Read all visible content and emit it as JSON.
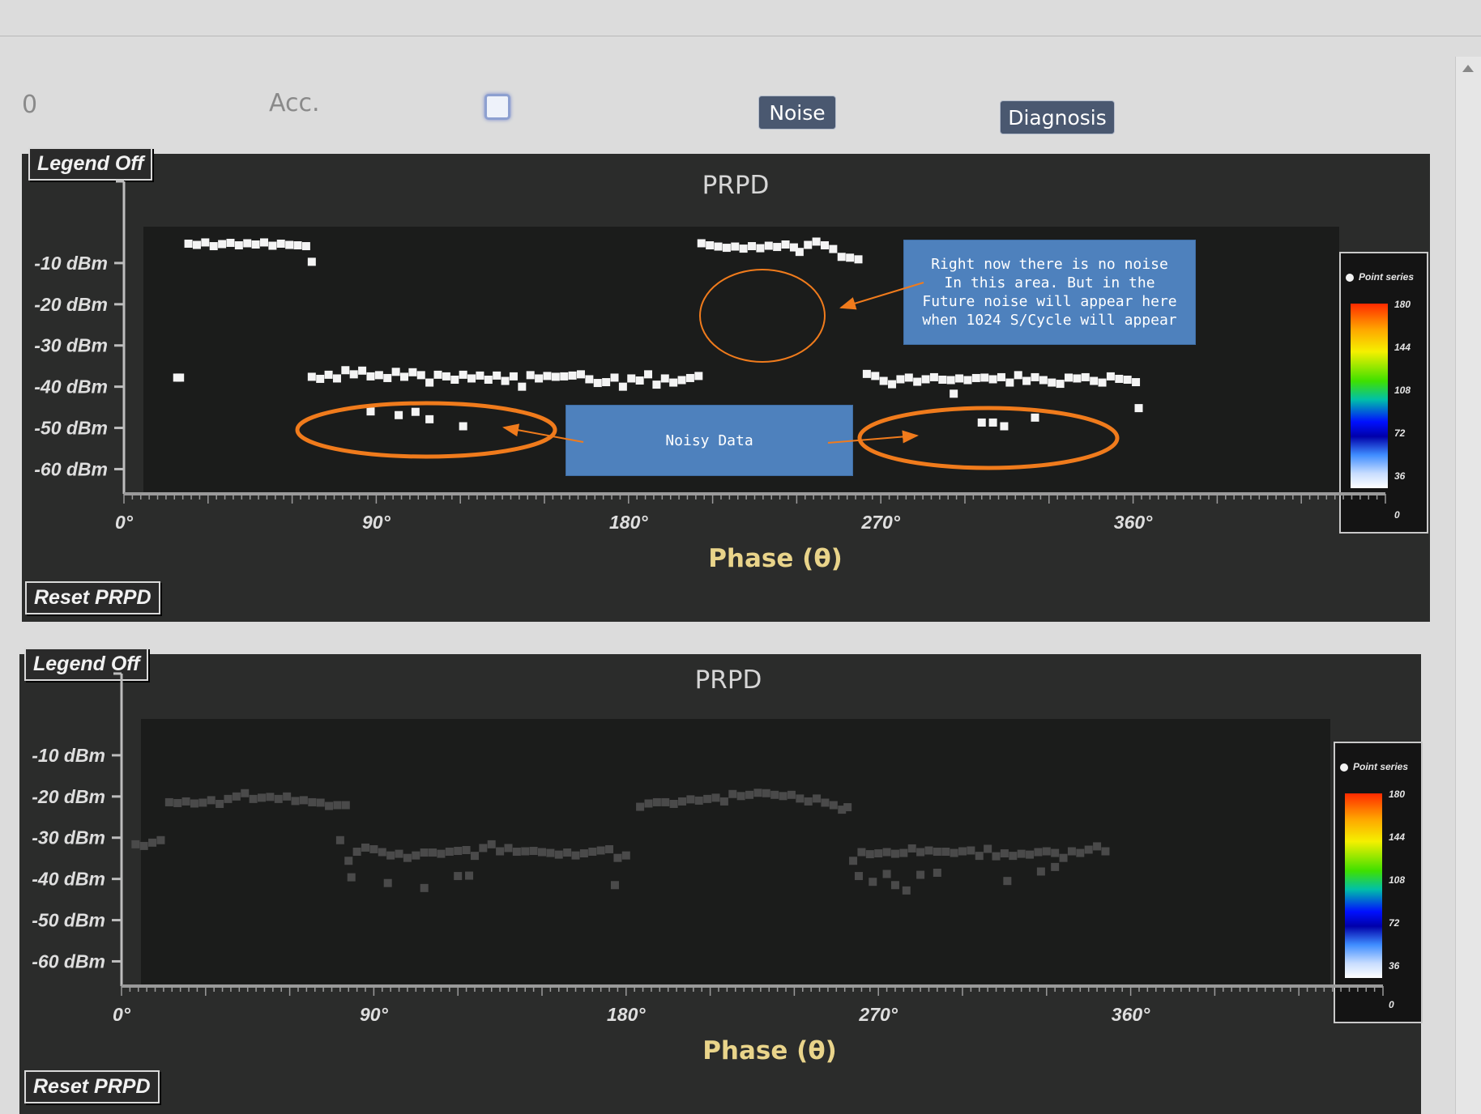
{
  "toolbar": {
    "left_value": "0",
    "acc_label": "Acc.",
    "noise_label": "Noise",
    "diagnosis_label": "Diagnosis"
  },
  "panels": [
    {
      "title": "PRPD",
      "legend_button": "Legend Off",
      "reset_button": "Reset PRPD",
      "legend": {
        "series": "Point series",
        "ticks": [
          "180",
          "144",
          "108",
          "72",
          "36",
          "0"
        ]
      }
    },
    {
      "title": "PRPD",
      "legend_button": "Legend Off",
      "reset_button": "Reset PRPD",
      "legend": {
        "series": "Point series",
        "ticks": [
          "180",
          "144",
          "108",
          "72",
          "36",
          "0"
        ]
      }
    }
  ],
  "annotations": {
    "callout_future": "Right now there is no noise\nIn this area. But in the\nFuture noise will appear here\nwhen 1024 S/Cycle will appear",
    "callout_noisy": "Noisy Data",
    "accent_color": "#f07b1c",
    "callout_color": "#4e81bd"
  },
  "chart_data": [
    {
      "type": "scatter",
      "title": "PRPD",
      "xlabel": "Phase (θ)",
      "ylabel": "",
      "x_ticks": [
        "0°",
        "90°",
        "180°",
        "270°",
        "360°"
      ],
      "y_ticks": [
        "-10 dBm",
        "-20 dBm",
        "-30 dBm",
        "-40 dBm",
        "-50 dBm",
        "-60 dBm"
      ],
      "xlim": [
        0,
        450
      ],
      "ylim": [
        -66,
        0
      ],
      "point_color": "#f4f4f4",
      "series": [
        {
          "points": [
            [
              23,
              -5.3
            ],
            [
              26,
              -5.6
            ],
            [
              29,
              -5.0
            ],
            [
              32,
              -5.9
            ],
            [
              35,
              -5.4
            ],
            [
              38,
              -5.1
            ],
            [
              41,
              -5.7
            ],
            [
              44,
              -5.2
            ],
            [
              47,
              -5.5
            ],
            [
              50,
              -5.0
            ],
            [
              53,
              -5.8
            ],
            [
              56,
              -5.3
            ],
            [
              59,
              -5.6
            ],
            [
              62,
              -5.7
            ],
            [
              65,
              -5.9
            ],
            [
              67,
              -9.7
            ],
            [
              206,
              -5.2
            ],
            [
              209,
              -5.7
            ],
            [
              212,
              -6.0
            ],
            [
              215,
              -6.3
            ],
            [
              218,
              -6.0
            ],
            [
              221,
              -6.5
            ],
            [
              224,
              -5.9
            ],
            [
              227,
              -6.4
            ],
            [
              230,
              -5.8
            ],
            [
              233,
              -6.1
            ],
            [
              236,
              -5.5
            ],
            [
              239,
              -6.2
            ],
            [
              241,
              -7.3
            ],
            [
              244,
              -5.6
            ],
            [
              247,
              -4.8
            ],
            [
              250,
              -5.7
            ],
            [
              253,
              -6.6
            ],
            [
              256,
              -8.5
            ],
            [
              259,
              -8.7
            ],
            [
              262,
              -9.1
            ],
            [
              19,
              -37.8
            ],
            [
              20,
              -37.8
            ],
            [
              67,
              -37.6
            ],
            [
              70,
              -38.1
            ],
            [
              73,
              -37.1
            ],
            [
              76,
              -38.0
            ],
            [
              79,
              -36.0
            ],
            [
              82,
              -37.0
            ],
            [
              85,
              -36.1
            ],
            [
              88,
              -37.5
            ],
            [
              91,
              -37.2
            ],
            [
              94,
              -37.9
            ],
            [
              97,
              -36.4
            ],
            [
              100,
              -37.6
            ],
            [
              103,
              -36.5
            ],
            [
              106,
              -37.2
            ],
            [
              109,
              -39.0
            ],
            [
              112,
              -37.1
            ],
            [
              115,
              -37.5
            ],
            [
              118,
              -38.3
            ],
            [
              121,
              -37.1
            ],
            [
              124,
              -38.0
            ],
            [
              127,
              -37.3
            ],
            [
              130,
              -38.3
            ],
            [
              133,
              -37.3
            ],
            [
              136,
              -38.6
            ],
            [
              139,
              -37.5
            ],
            [
              142,
              -40.0
            ],
            [
              145,
              -37.2
            ],
            [
              148,
              -38.0
            ],
            [
              151,
              -37.4
            ],
            [
              154,
              -37.6
            ],
            [
              157,
              -37.5
            ],
            [
              160,
              -37.3
            ],
            [
              163,
              -37.0
            ],
            [
              166,
              -38.2
            ],
            [
              169,
              -39.1
            ],
            [
              172,
              -38.9
            ],
            [
              175,
              -37.8
            ],
            [
              178,
              -40.0
            ],
            [
              181,
              -38.0
            ],
            [
              184,
              -38.5
            ],
            [
              187,
              -37.0
            ],
            [
              190,
              -39.5
            ],
            [
              193,
              -38.0
            ],
            [
              196,
              -39.0
            ],
            [
              199,
              -38.4
            ],
            [
              202,
              -37.9
            ],
            [
              205,
              -37.4
            ],
            [
              265,
              -36.9
            ],
            [
              268,
              -37.4
            ],
            [
              271,
              -38.6
            ],
            [
              274,
              -39.4
            ],
            [
              277,
              -38.2
            ],
            [
              280,
              -37.8
            ],
            [
              283,
              -38.8
            ],
            [
              286,
              -38.2
            ],
            [
              289,
              -37.7
            ],
            [
              292,
              -38.3
            ],
            [
              295,
              -38.4
            ],
            [
              298,
              -38.0
            ],
            [
              301,
              -38.4
            ],
            [
              304,
              -37.9
            ],
            [
              307,
              -37.8
            ],
            [
              310,
              -38.2
            ],
            [
              313,
              -37.7
            ],
            [
              316,
              -39.0
            ],
            [
              319,
              -37.2
            ],
            [
              322,
              -38.6
            ],
            [
              325,
              -37.7
            ],
            [
              328,
              -38.4
            ],
            [
              331,
              -39.0
            ],
            [
              334,
              -39.3
            ],
            [
              337,
              -37.8
            ],
            [
              340,
              -38.0
            ],
            [
              343,
              -37.7
            ],
            [
              346,
              -38.6
            ],
            [
              349,
              -39.0
            ],
            [
              352,
              -37.5
            ],
            [
              355,
              -38.1
            ],
            [
              358,
              -38.3
            ],
            [
              361,
              -38.9
            ],
            [
              296,
              -41.7
            ],
            [
              362,
              -45.2
            ],
            [
              88,
              -46.0
            ],
            [
              98,
              -46.9
            ],
            [
              104,
              -46.1
            ],
            [
              109,
              -47.9
            ],
            [
              121,
              -49.6
            ],
            [
              306,
              -48.7
            ],
            [
              310,
              -48.7
            ],
            [
              314,
              -49.6
            ],
            [
              325,
              -47.5
            ]
          ]
        }
      ]
    },
    {
      "type": "scatter",
      "title": "PRPD",
      "xlabel": "Phase (θ)",
      "ylabel": "",
      "x_ticks": [
        "0°",
        "90°",
        "180°",
        "270°",
        "360°"
      ],
      "y_ticks": [
        "-10 dBm",
        "-20 dBm",
        "-30 dBm",
        "-40 dBm",
        "-50 dBm",
        "-60 dBm"
      ],
      "xlim": [
        0,
        450
      ],
      "ylim": [
        -66,
        0
      ],
      "point_color": "#4a4a4a",
      "series": [
        {
          "points": [
            [
              5,
              -31.6
            ],
            [
              8,
              -32.0
            ],
            [
              11,
              -31.2
            ],
            [
              14,
              -30.6
            ],
            [
              17,
              -21.4
            ],
            [
              20,
              -21.6
            ],
            [
              23,
              -21.2
            ],
            [
              26,
              -21.7
            ],
            [
              29,
              -21.5
            ],
            [
              32,
              -20.9
            ],
            [
              35,
              -21.8
            ],
            [
              38,
              -20.6
            ],
            [
              41,
              -20.0
            ],
            [
              44,
              -19.2
            ],
            [
              47,
              -20.6
            ],
            [
              50,
              -20.3
            ],
            [
              53,
              -20.1
            ],
            [
              56,
              -20.6
            ],
            [
              59,
              -20.0
            ],
            [
              62,
              -21.1
            ],
            [
              65,
              -20.9
            ],
            [
              68,
              -21.4
            ],
            [
              71,
              -21.5
            ],
            [
              74,
              -22.3
            ],
            [
              77,
              -22.1
            ],
            [
              80,
              -22.1
            ],
            [
              185,
              -22.5
            ],
            [
              188,
              -21.7
            ],
            [
              191,
              -21.4
            ],
            [
              194,
              -21.4
            ],
            [
              197,
              -21.8
            ],
            [
              200,
              -21.2
            ],
            [
              203,
              -20.7
            ],
            [
              206,
              -21.0
            ],
            [
              209,
              -20.6
            ],
            [
              212,
              -20.3
            ],
            [
              215,
              -21.2
            ],
            [
              218,
              -19.4
            ],
            [
              221,
              -19.9
            ],
            [
              224,
              -19.6
            ],
            [
              227,
              -19.1
            ],
            [
              230,
              -19.2
            ],
            [
              233,
              -19.6
            ],
            [
              236,
              -19.9
            ],
            [
              239,
              -19.6
            ],
            [
              242,
              -20.5
            ],
            [
              245,
              -21.2
            ],
            [
              248,
              -20.5
            ],
            [
              251,
              -21.5
            ],
            [
              254,
              -22.1
            ],
            [
              257,
              -23.2
            ],
            [
              259,
              -22.6
            ],
            [
              78,
              -30.6
            ],
            [
              81,
              -35.6
            ],
            [
              84,
              -33.4
            ],
            [
              87,
              -32.4
            ],
            [
              90,
              -32.8
            ],
            [
              93,
              -33.5
            ],
            [
              96,
              -34.3
            ],
            [
              99,
              -33.9
            ],
            [
              102,
              -34.9
            ],
            [
              105,
              -34.3
            ],
            [
              108,
              -33.6
            ],
            [
              111,
              -33.6
            ],
            [
              114,
              -33.9
            ],
            [
              117,
              -33.4
            ],
            [
              120,
              -33.2
            ],
            [
              123,
              -33.0
            ],
            [
              126,
              -34.4
            ],
            [
              129,
              -32.5
            ],
            [
              132,
              -31.6
            ],
            [
              135,
              -33.3
            ],
            [
              138,
              -32.5
            ],
            [
              141,
              -33.4
            ],
            [
              144,
              -33.3
            ],
            [
              147,
              -33.2
            ],
            [
              150,
              -33.5
            ],
            [
              153,
              -33.7
            ],
            [
              156,
              -34.1
            ],
            [
              159,
              -33.6
            ],
            [
              162,
              -34.3
            ],
            [
              165,
              -33.8
            ],
            [
              168,
              -33.4
            ],
            [
              171,
              -33.1
            ],
            [
              174,
              -32.8
            ],
            [
              177,
              -34.9
            ],
            [
              180,
              -34.3
            ],
            [
              261,
              -35.6
            ],
            [
              264,
              -33.5
            ],
            [
              267,
              -34.0
            ],
            [
              270,
              -33.8
            ],
            [
              273,
              -33.5
            ],
            [
              276,
              -33.9
            ],
            [
              279,
              -33.7
            ],
            [
              282,
              -32.6
            ],
            [
              285,
              -33.5
            ],
            [
              288,
              -33.1
            ],
            [
              291,
              -33.4
            ],
            [
              294,
              -33.4
            ],
            [
              297,
              -33.7
            ],
            [
              300,
              -33.3
            ],
            [
              303,
              -33.1
            ],
            [
              306,
              -34.4
            ],
            [
              309,
              -32.7
            ],
            [
              312,
              -34.5
            ],
            [
              315,
              -33.8
            ],
            [
              318,
              -34.4
            ],
            [
              321,
              -33.9
            ],
            [
              324,
              -34.1
            ],
            [
              327,
              -33.5
            ],
            [
              330,
              -33.3
            ],
            [
              333,
              -33.7
            ],
            [
              336,
              -34.9
            ],
            [
              339,
              -33.3
            ],
            [
              342,
              -33.7
            ],
            [
              345,
              -32.9
            ],
            [
              348,
              -32.1
            ],
            [
              351,
              -33.3
            ],
            [
              82,
              -39.6
            ],
            [
              95,
              -41.0
            ],
            [
              108,
              -42.2
            ],
            [
              120,
              -39.3
            ],
            [
              124,
              -39.2
            ],
            [
              176,
              -41.5
            ],
            [
              263,
              -39.3
            ],
            [
              268,
              -40.7
            ],
            [
              273,
              -38.8
            ],
            [
              276,
              -41.5
            ],
            [
              280,
              -42.8
            ],
            [
              285,
              -39.0
            ],
            [
              291,
              -38.5
            ],
            [
              316,
              -40.5
            ],
            [
              328,
              -38.2
            ],
            [
              333,
              -37.1
            ]
          ]
        }
      ]
    }
  ]
}
